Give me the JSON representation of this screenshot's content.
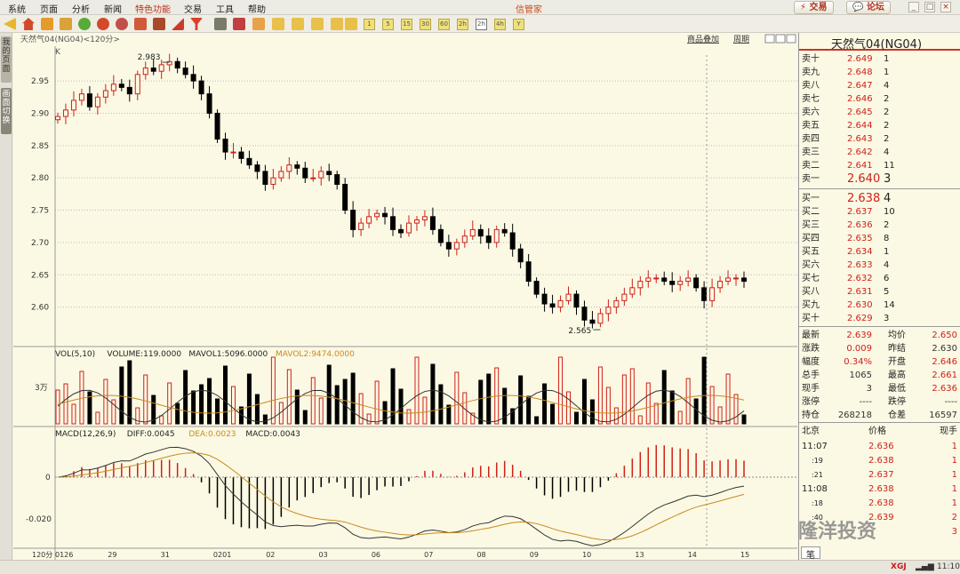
{
  "menu": [
    "系统",
    "页面",
    "分析",
    "新闻",
    "特色功能",
    "交易",
    "工具",
    "帮助"
  ],
  "app_title": "信管家",
  "top_buttons": {
    "trade": "交易",
    "forum": "论坛"
  },
  "toolbar_periods": [
    "1",
    "5",
    "15",
    "30",
    "60",
    "2h",
    "4h",
    "Y"
  ],
  "sidebar": {
    "tab1": "我的页面",
    "tab2": "画面切换"
  },
  "chart_header": {
    "symbol_label": "天然气04(NG04)<120分>",
    "overlay_link": "商品叠加",
    "period_link": "周期",
    "axis_unit": "K"
  },
  "chart_data": [
    {
      "type": "candlestick",
      "title": "天然气04(NG04)<120分>",
      "ylim": [
        2.55,
        2.99
      ],
      "y_ticks": [
        2.95,
        2.9,
        2.85,
        2.8,
        2.75,
        2.7,
        2.65,
        2.6
      ],
      "x_labels": [
        "0126",
        "29",
        "31",
        "0201",
        "02",
        "03",
        "06",
        "07",
        "08",
        "09",
        "10",
        "13",
        "14",
        "15"
      ],
      "annotations": [
        {
          "text": "2.983",
          "value": 2.983
        },
        {
          "text": "2.565",
          "value": 2.565
        }
      ],
      "close_approx": [
        2.895,
        2.905,
        2.92,
        2.93,
        2.91,
        2.925,
        2.935,
        2.945,
        2.94,
        2.93,
        2.96,
        2.97,
        2.965,
        2.975,
        2.98,
        2.97,
        2.96,
        2.95,
        2.93,
        2.9,
        2.86,
        2.84,
        2.84,
        2.83,
        2.82,
        2.81,
        2.79,
        2.8,
        2.81,
        2.82,
        2.815,
        2.8,
        2.8,
        2.81,
        2.805,
        2.79,
        2.75,
        2.72,
        2.73,
        2.74,
        2.745,
        2.74,
        2.72,
        2.715,
        2.73,
        2.735,
        2.74,
        2.72,
        2.7,
        2.69,
        2.7,
        2.71,
        2.72,
        2.71,
        2.7,
        2.72,
        2.715,
        2.69,
        2.67,
        2.64,
        2.62,
        2.605,
        2.6,
        2.61,
        2.62,
        2.6,
        2.58,
        2.575,
        2.59,
        2.6,
        2.61,
        2.62,
        2.63,
        2.64,
        2.645,
        2.645,
        2.64,
        2.635,
        2.64,
        2.645,
        2.63,
        2.61,
        2.63,
        2.64,
        2.645,
        2.645,
        2.64
      ]
    },
    {
      "type": "bar",
      "title": "VOL(5,10)",
      "legend": [
        {
          "text": "VOL(5,10)",
          "color": "#222222"
        },
        {
          "text": "VOLUME:119.0000",
          "color": "#222222"
        },
        {
          "text": "MAVOL1:5096.0000",
          "color": "#222222"
        },
        {
          "text": "MAVOL2:9474.0000",
          "color": "#c98a1e"
        }
      ],
      "y_tick": "3万"
    },
    {
      "type": "line",
      "title": "MACD(12,26,9)",
      "legend": [
        {
          "text": "MACD(12,26,9)",
          "color": "#222222"
        },
        {
          "text": "DIFF:0.0045",
          "color": "#222222"
        },
        {
          "text": "DEA:0.0023",
          "color": "#c98a1e"
        },
        {
          "text": "MACD:0.0043",
          "color": "#222222"
        }
      ],
      "y_ticks": [
        "0",
        "-0.020"
      ],
      "x_axis_label": "120分"
    }
  ],
  "quote_panel": {
    "title": "天然气04(NG04)",
    "asks": [
      {
        "label": "卖十",
        "price": "2.649",
        "vol": "1"
      },
      {
        "label": "卖九",
        "price": "2.648",
        "vol": "1"
      },
      {
        "label": "卖八",
        "price": "2.647",
        "vol": "4"
      },
      {
        "label": "卖七",
        "price": "2.646",
        "vol": "2"
      },
      {
        "label": "卖六",
        "price": "2.645",
        "vol": "2"
      },
      {
        "label": "卖五",
        "price": "2.644",
        "vol": "2"
      },
      {
        "label": "卖四",
        "price": "2.643",
        "vol": "2"
      },
      {
        "label": "卖三",
        "price": "2.642",
        "vol": "4"
      },
      {
        "label": "卖二",
        "price": "2.641",
        "vol": "11"
      },
      {
        "label": "卖一",
        "price": "2.640",
        "vol": "3"
      }
    ],
    "bids": [
      {
        "label": "买一",
        "price": "2.638",
        "vol": "4"
      },
      {
        "label": "买二",
        "price": "2.637",
        "vol": "10"
      },
      {
        "label": "买三",
        "price": "2.636",
        "vol": "2"
      },
      {
        "label": "买四",
        "price": "2.635",
        "vol": "8"
      },
      {
        "label": "买五",
        "price": "2.634",
        "vol": "1"
      },
      {
        "label": "买六",
        "price": "2.633",
        "vol": "4"
      },
      {
        "label": "买七",
        "price": "2.632",
        "vol": "6"
      },
      {
        "label": "买八",
        "price": "2.631",
        "vol": "5"
      },
      {
        "label": "买九",
        "price": "2.630",
        "vol": "14"
      },
      {
        "label": "买十",
        "price": "2.629",
        "vol": "3"
      }
    ],
    "stats": [
      {
        "l1": "最新",
        "v1": "2.639",
        "l2": "均价",
        "v2": "2.650",
        "c1": "#d0201a",
        "c2": "#d0201a"
      },
      {
        "l1": "涨跌",
        "v1": "0.009",
        "l2": "昨结",
        "v2": "2.630",
        "c1": "#d0201a",
        "c2": "#333333"
      },
      {
        "l1": "幅度",
        "v1": "0.34%",
        "l2": "开盘",
        "v2": "2.646",
        "c1": "#d0201a",
        "c2": "#d0201a"
      },
      {
        "l1": "总手",
        "v1": "1065",
        "l2": "最高",
        "v2": "2.661",
        "c1": "#333333",
        "c2": "#d0201a"
      },
      {
        "l1": "现手",
        "v1": "3",
        "l2": "最低",
        "v2": "2.636",
        "c1": "#333333",
        "c2": "#d0201a"
      },
      {
        "l1": "涨停",
        "v1": "----",
        "l2": "跌停",
        "v2": "----",
        "c1": "#333333",
        "c2": "#333333"
      },
      {
        "l1": "持仓",
        "v1": "268218",
        "l2": "仓差",
        "v2": "16597",
        "c1": "#333333",
        "c2": "#333333"
      }
    ],
    "ticks_header": {
      "place": "北京",
      "price": "价格",
      "qty": "现手"
    },
    "ticks": [
      {
        "time": "11:07",
        "price": "2.636",
        "qty": "1"
      },
      {
        "time": ":19",
        "price": "2.638",
        "qty": "1"
      },
      {
        "time": ":21",
        "price": "2.637",
        "qty": "1"
      },
      {
        "time": "11:08",
        "price": "2.638",
        "qty": "1"
      },
      {
        "time": ":18",
        "price": "2.638",
        "qty": "1"
      },
      {
        "time": ":40",
        "price": "2.639",
        "qty": "2"
      },
      {
        "time": "",
        "price": "",
        "qty": "3"
      }
    ],
    "bottom_tab": "笔"
  },
  "watermark": "隆洋投资",
  "status": {
    "brand": "XGJ",
    "time": "11:10"
  },
  "colors": {
    "up": "#d0201a",
    "down": "#000000",
    "dea": "#c98a1e",
    "diff": "#333333",
    "accent": "#d14a1a"
  }
}
